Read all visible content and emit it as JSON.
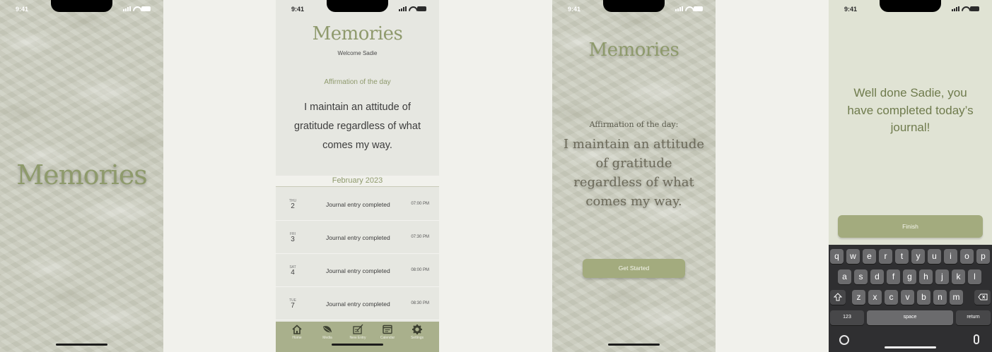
{
  "status_bar": {
    "time": "9:41"
  },
  "splash": {
    "logo": "Memories"
  },
  "home": {
    "logo": "Memories",
    "welcome": "Welcome Sadie",
    "affirmation_heading": "Affirmation of the day",
    "affirmation_text": "I maintain an attitude of gratitude regardless of what comes my way.",
    "month": "February 2023",
    "entries": [
      {
        "dow": "THU",
        "day": "2",
        "text": "Journal entry completed",
        "time": "07:00 PM"
      },
      {
        "dow": "FRI",
        "day": "3",
        "text": "Journal entry completed",
        "time": "07:30 PM"
      },
      {
        "dow": "SAT",
        "day": "4",
        "text": "Journal entry completed",
        "time": "08:00 PM"
      },
      {
        "dow": "TUE",
        "day": "7",
        "text": "Journal entry completed",
        "time": "08:30 PM"
      }
    ],
    "tabs": [
      {
        "label": "Home",
        "icon": "home-icon"
      },
      {
        "label": "Media",
        "icon": "leaf-icon"
      },
      {
        "label": "New Entry",
        "icon": "new-entry-icon"
      },
      {
        "label": "Calendar",
        "icon": "calendar-icon"
      },
      {
        "label": "Settings",
        "icon": "gear-icon"
      }
    ],
    "colors": {
      "accent": "#8f9a6d",
      "tabbar": "#a9b08c",
      "background": "#e6e7e1"
    }
  },
  "welcome_screen": {
    "logo": "Memories",
    "affirmation_heading": "Affirmation of the day:",
    "affirmation_text": "I maintain an attitude of gratitude regardless of what comes my way.",
    "button": "Get Started",
    "colors": {
      "button": "#a3ab7e"
    }
  },
  "completion_screen": {
    "message": "Well done Sadie, you have completed today’s journal!",
    "button": "Finish",
    "keyboard": {
      "row1": [
        "q",
        "w",
        "e",
        "r",
        "t",
        "y",
        "u",
        "i",
        "o",
        "p"
      ],
      "row2": [
        "a",
        "s",
        "d",
        "f",
        "g",
        "h",
        "j",
        "k",
        "l"
      ],
      "row3": [
        "z",
        "x",
        "c",
        "v",
        "b",
        "n",
        "m"
      ],
      "numbers_key": "123",
      "space_key": "space",
      "return_key": "return"
    },
    "colors": {
      "background": "#e0e3d4",
      "text": "#6f7b4d"
    }
  }
}
